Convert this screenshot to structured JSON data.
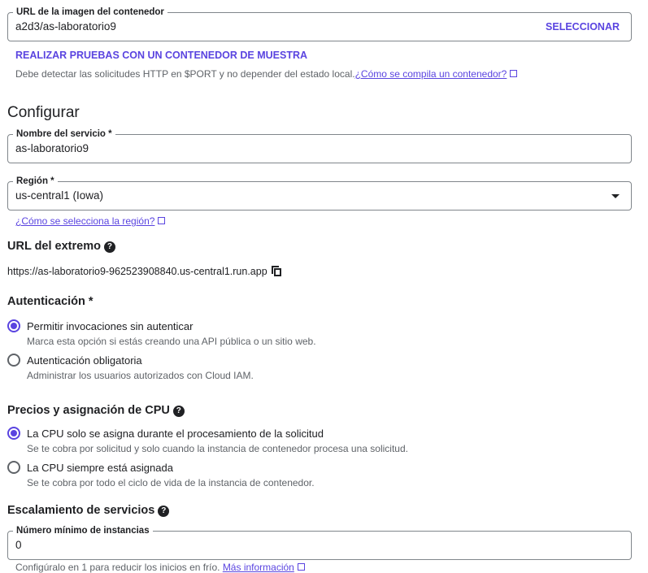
{
  "container": {
    "label": "URL de la imagen del contenedor",
    "value": "a2d3/as-laboratorio9",
    "select": "SELECCIONAR",
    "sample": "REALIZAR PRUEBAS CON UN CONTENEDOR DE MUESTRA",
    "help": "Debe detectar las solicitudes HTTP en $PORT y no depender del estado local.",
    "help_link": "¿Cómo se compila un contenedor?"
  },
  "configure": {
    "title": "Configurar",
    "service_name": {
      "label": "Nombre del servicio *",
      "value": "as-laboratorio9"
    },
    "region": {
      "label": "Región *",
      "value": "us-central1 (Iowa)",
      "link": "¿Cómo se selecciona la región?"
    }
  },
  "endpoint": {
    "title": "URL del extremo",
    "url": "https://as-laboratorio9-962523908840.us-central1.run.app"
  },
  "auth": {
    "title": "Autenticación *",
    "options": [
      {
        "label": "Permitir invocaciones sin autenticar",
        "desc": "Marca esta opción si estás creando una API pública o un sitio web.",
        "selected": true
      },
      {
        "label": "Autenticación obligatoria",
        "desc": "Administrar los usuarios autorizados con Cloud IAM.",
        "selected": false
      }
    ]
  },
  "cpu": {
    "title": "Precios y asignación de CPU",
    "options": [
      {
        "label": "La CPU solo se asigna durante el procesamiento de la solicitud",
        "desc": "Se te cobra por solicitud y solo cuando la instancia de contenedor procesa una solicitud.",
        "selected": true
      },
      {
        "label": "La CPU siempre está asignada",
        "desc": "Se te cobra por todo el ciclo de vida de la instancia de contenedor.",
        "selected": false
      }
    ]
  },
  "scaling": {
    "title": "Escalamiento de servicios",
    "min_label": "Número mínimo de instancias",
    "min_value": "0",
    "help": "Configúralo en 1 para reducir los inicios en frío.",
    "help_link": "Más información"
  },
  "colors": {
    "accent": "#5a44e0"
  }
}
